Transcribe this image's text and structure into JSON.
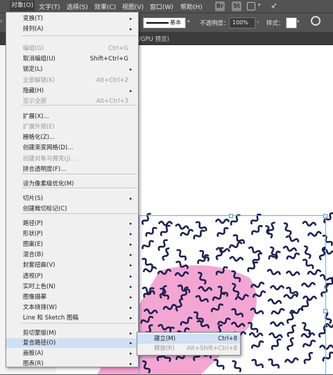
{
  "menubar": {
    "items": [
      "对象(O)",
      "文字(T)",
      "选择(S)",
      "效果(C)",
      "视图(V)",
      "窗口(W)",
      "帮助(H)"
    ],
    "icons": [
      "Br",
      "St"
    ]
  },
  "toolbar": {
    "stroke_label": "基本",
    "opacity_label": "不透明度：",
    "opacity_value": "100%",
    "style_label": "样式："
  },
  "tab": {
    "label": "/GPU 预览)"
  },
  "object_menu": {
    "items": [
      {
        "label": "变换(T)",
        "shortcut": "",
        "submenu": true,
        "disabled": false
      },
      {
        "label": "排列(A)",
        "shortcut": "",
        "submenu": true,
        "disabled": false
      },
      {
        "label": "编组(G)",
        "shortcut": "Ctrl+G",
        "submenu": false,
        "disabled": true
      },
      {
        "label": "取消编组(U)",
        "shortcut": "Shift+Ctrl+G",
        "submenu": false,
        "disabled": false
      },
      {
        "label": "锁定(L)",
        "shortcut": "",
        "submenu": true,
        "disabled": false
      },
      {
        "label": "全部解锁(K)",
        "shortcut": "Alt+Ctrl+2",
        "submenu": false,
        "disabled": true
      },
      {
        "label": "隐藏(H)",
        "shortcut": "",
        "submenu": true,
        "disabled": false
      },
      {
        "label": "显示全部",
        "shortcut": "Alt+Ctrl+3",
        "submenu": false,
        "disabled": true
      },
      {
        "label": "扩展(X)...",
        "shortcut": "",
        "submenu": false,
        "disabled": false
      },
      {
        "label": "扩展外观(E)",
        "shortcut": "",
        "submenu": false,
        "disabled": true
      },
      {
        "label": "栅格化(Z)...",
        "shortcut": "",
        "submenu": false,
        "disabled": false
      },
      {
        "label": "创建渐变网格(D)...",
        "shortcut": "",
        "submenu": false,
        "disabled": false
      },
      {
        "label": "创建对象马赛克(J)...",
        "shortcut": "",
        "submenu": false,
        "disabled": true
      },
      {
        "label": "拼合透明度(F)...",
        "shortcut": "",
        "submenu": false,
        "disabled": false
      },
      {
        "label": "设为像素级优化(M)",
        "shortcut": "",
        "submenu": false,
        "disabled": false
      },
      {
        "label": "切片(S)",
        "shortcut": "",
        "submenu": true,
        "disabled": false
      },
      {
        "label": "创建裁切标记(C)",
        "shortcut": "",
        "submenu": false,
        "disabled": false
      },
      {
        "label": "路径(P)",
        "shortcut": "",
        "submenu": true,
        "disabled": false
      },
      {
        "label": "形状(P)",
        "shortcut": "",
        "submenu": true,
        "disabled": false
      },
      {
        "label": "图案(E)",
        "shortcut": "",
        "submenu": true,
        "disabled": false
      },
      {
        "label": "混合(B)",
        "shortcut": "",
        "submenu": true,
        "disabled": false
      },
      {
        "label": "封套扭曲(V)",
        "shortcut": "",
        "submenu": true,
        "disabled": false
      },
      {
        "label": "透视(P)",
        "shortcut": "",
        "submenu": true,
        "disabled": false
      },
      {
        "label": "实时上色(N)",
        "shortcut": "",
        "submenu": true,
        "disabled": false
      },
      {
        "label": "图像描摹",
        "shortcut": "",
        "submenu": true,
        "disabled": false
      },
      {
        "label": "文本绕排(W)",
        "shortcut": "",
        "submenu": true,
        "disabled": false
      },
      {
        "label": "Line 和 Sketch 图稿",
        "shortcut": "",
        "submenu": true,
        "disabled": false
      },
      {
        "label": "剪切蒙版(M)",
        "shortcut": "",
        "submenu": true,
        "disabled": false
      },
      {
        "label": "复合路径(O)",
        "shortcut": "",
        "submenu": true,
        "disabled": false,
        "highlighted": true
      },
      {
        "label": "画板(A)",
        "shortcut": "",
        "submenu": true,
        "disabled": false
      },
      {
        "label": "图表(R)",
        "shortcut": "",
        "submenu": true,
        "disabled": false
      }
    ]
  },
  "compound_submenu": {
    "items": [
      {
        "label": "建立(M)",
        "shortcut": "Ctrl+8",
        "disabled": false,
        "highlighted": true
      },
      {
        "label": "释放(R)",
        "shortcut": "Alt+Shift+Ctrl+8",
        "disabled": true
      }
    ]
  },
  "colors": {
    "accent_pink": "#f4a6d2",
    "squiggle": "#1a2050",
    "menu_highlight": "#cfe0f6"
  }
}
